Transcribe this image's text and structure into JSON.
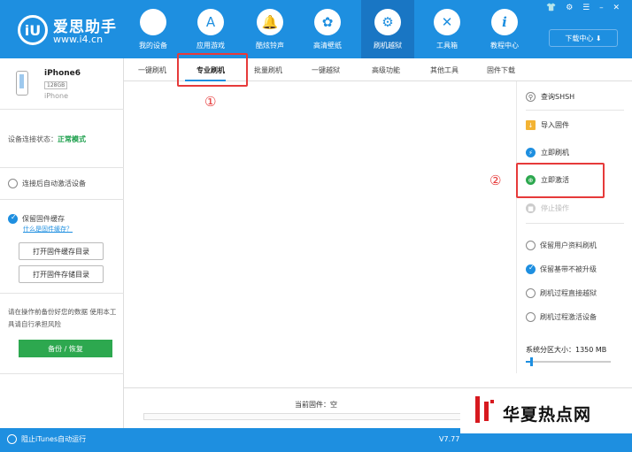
{
  "brand": {
    "name": "爱思助手",
    "url": "www.i4.cn",
    "logo_text": "iU"
  },
  "nav": [
    {
      "label": "我的设备",
      "icon": "apple-icon",
      "glyph": ""
    },
    {
      "label": "应用游戏",
      "icon": "app-store-icon",
      "glyph": "A"
    },
    {
      "label": "酷炫铃声",
      "icon": "bell-icon",
      "glyph": "🔔"
    },
    {
      "label": "高清壁纸",
      "icon": "flower-icon",
      "glyph": "✿"
    },
    {
      "label": "刷机越狱",
      "icon": "flash-box-icon",
      "glyph": "⚙"
    },
    {
      "label": "工具箱",
      "icon": "tools-icon",
      "glyph": "✕"
    },
    {
      "label": "教程中心",
      "icon": "info-icon",
      "glyph": "i"
    }
  ],
  "window_controls": "👕 ⚙ ☰ – ✕",
  "download_center": "下载中心 ⬇",
  "device": {
    "name": "iPhone6",
    "capacity": "128GB",
    "type": "iPhone"
  },
  "status": {
    "label": "设备连接状态：",
    "value": "正常模式"
  },
  "auto_activate": "连接后自动激活设备",
  "cache": {
    "keep_label": "保留固件缓存",
    "what_link": "什么是固件缓存？",
    "open_cache_dir": "打开固件缓存目录",
    "open_store_dir": "打开固件存储目录"
  },
  "warning": "请在操作前备份好您的数据 使用本工具请自行承担风险",
  "backup_button": "备份 / 恢复",
  "tabs": [
    "一键刷机",
    "专业刷机",
    "批量刷机",
    "一键越狱",
    "高级功能",
    "其他工具",
    "固件下载"
  ],
  "annotations": {
    "mark1": "①",
    "mark2": "②"
  },
  "actions": [
    {
      "label": "查询SHSH",
      "icon": "search-shsh-icon",
      "disabled": false
    },
    {
      "label": "导入固件",
      "icon": "import-folder-icon",
      "disabled": false
    },
    {
      "label": "立即刷机",
      "icon": "flash-icon",
      "disabled": false
    },
    {
      "label": "立即激活",
      "icon": "globe-icon",
      "disabled": false
    },
    {
      "label": "停止操作",
      "icon": "stop-icon",
      "disabled": true
    }
  ],
  "options": [
    {
      "label": "保留用户资料刷机",
      "checked": false
    },
    {
      "label": "保留基带不被升级",
      "checked": true
    },
    {
      "label": "刷机过程直接越狱",
      "checked": false
    },
    {
      "label": "刷机过程激活设备",
      "checked": false
    }
  ],
  "partition": {
    "label": "系统分区大小：1350 MB",
    "fraction": 0.05
  },
  "firmware": {
    "label": "当前固件：空"
  },
  "bottom": {
    "itunes": "阻止iTunes自动运行",
    "version": "V7.77"
  },
  "watermark": "华夏热点网",
  "colors": {
    "primary": "#1e8fe0",
    "green": "#2da84f",
    "highlight": "#e63a3a"
  }
}
